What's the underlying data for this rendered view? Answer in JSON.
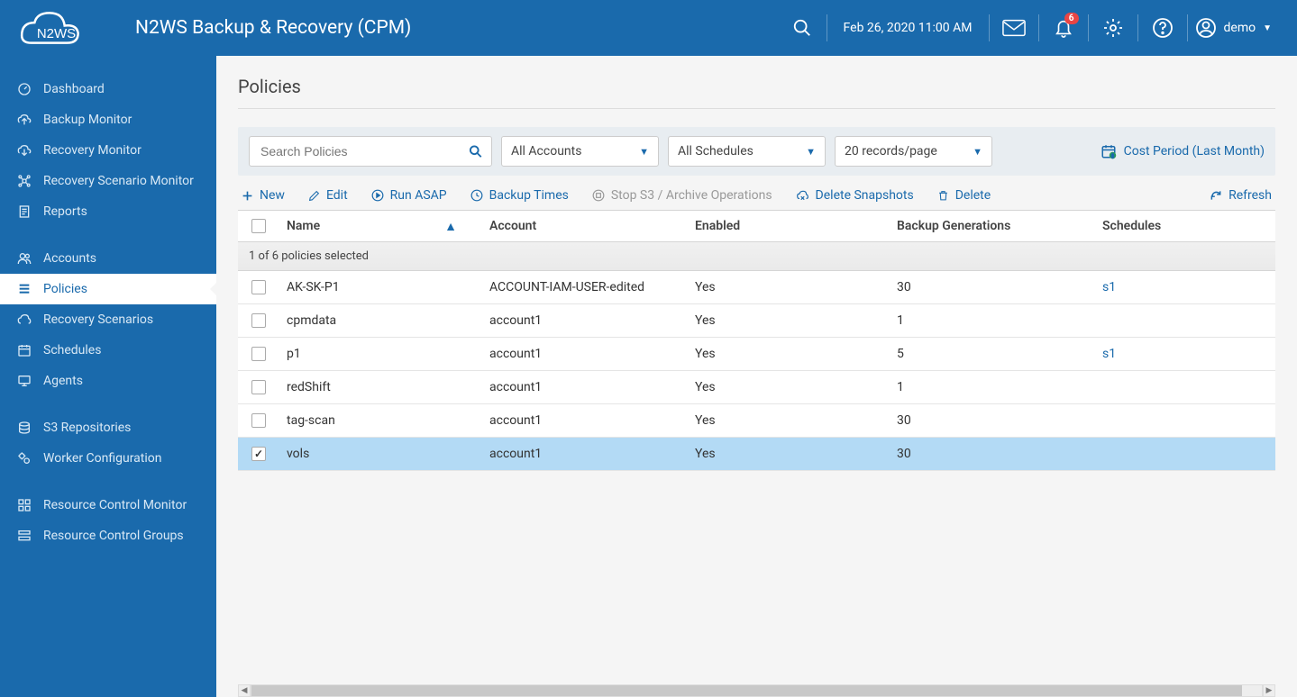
{
  "header": {
    "app_title": "N2WS Backup & Recovery (CPM)",
    "timestamp": "Feb 26, 2020 11:00 AM",
    "notification_count": "6",
    "user_name": "demo"
  },
  "sidebar": {
    "groups": [
      [
        {
          "icon": "dashboard",
          "label": "Dashboard"
        },
        {
          "icon": "backup",
          "label": "Backup Monitor"
        },
        {
          "icon": "recovery",
          "label": "Recovery Monitor"
        },
        {
          "icon": "scenario",
          "label": "Recovery Scenario Monitor"
        },
        {
          "icon": "reports",
          "label": "Reports"
        }
      ],
      [
        {
          "icon": "accounts",
          "label": "Accounts"
        },
        {
          "icon": "policies",
          "label": "Policies",
          "active": true
        },
        {
          "icon": "recoveryscen",
          "label": "Recovery Scenarios"
        },
        {
          "icon": "schedules",
          "label": "Schedules"
        },
        {
          "icon": "agents",
          "label": "Agents"
        }
      ],
      [
        {
          "icon": "s3",
          "label": "S3 Repositories"
        },
        {
          "icon": "worker",
          "label": "Worker Configuration"
        }
      ],
      [
        {
          "icon": "rcm",
          "label": "Resource Control Monitor"
        },
        {
          "icon": "rcg",
          "label": "Resource Control Groups"
        }
      ]
    ]
  },
  "page": {
    "title": "Policies"
  },
  "filters": {
    "search_placeholder": "Search Policies",
    "account": "All Accounts",
    "schedule": "All Schedules",
    "page_size": "20 records/page",
    "cost_period": "Cost Period (Last Month)"
  },
  "actions": {
    "new": "New",
    "edit": "Edit",
    "run_asap": "Run ASAP",
    "backup_times": "Backup Times",
    "stop_s3": "Stop S3 / Archive Operations",
    "delete_snapshots": "Delete Snapshots",
    "delete": "Delete",
    "refresh": "Refresh"
  },
  "table": {
    "columns": {
      "name": "Name",
      "account": "Account",
      "enabled": "Enabled",
      "backup": "Backup Generations",
      "schedules": "Schedules"
    },
    "selection_text": "1 of 6 policies selected",
    "rows": [
      {
        "name": "AK-SK-P1",
        "account": "ACCOUNT-IAM-USER-edited",
        "enabled": "Yes",
        "backup": "30",
        "schedule": "s1",
        "checked": false
      },
      {
        "name": "cpmdata",
        "account": "account1",
        "enabled": "Yes",
        "backup": "1",
        "schedule": "",
        "checked": false
      },
      {
        "name": "p1",
        "account": "account1",
        "enabled": "Yes",
        "backup": "5",
        "schedule": "s1",
        "checked": false
      },
      {
        "name": "redShift",
        "account": "account1",
        "enabled": "Yes",
        "backup": "1",
        "schedule": "",
        "checked": false
      },
      {
        "name": "tag-scan",
        "account": "account1",
        "enabled": "Yes",
        "backup": "30",
        "schedule": "",
        "checked": false
      },
      {
        "name": "vols",
        "account": "account1",
        "enabled": "Yes",
        "backup": "30",
        "schedule": "",
        "checked": true
      }
    ]
  }
}
